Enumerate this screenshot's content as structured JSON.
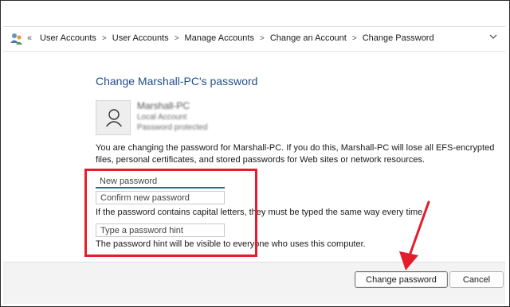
{
  "breadcrumb": {
    "items": [
      "User Accounts",
      "User Accounts",
      "Manage Accounts",
      "Change an Account",
      "Change Password"
    ],
    "back_glyph": "«"
  },
  "page": {
    "title": "Change Marshall-PC's password"
  },
  "account": {
    "name": "Marshall-PC",
    "type": "Local Account",
    "status": "Password protected"
  },
  "description": "You are changing the password for Marshall-PC.  If you do this, Marshall-PC will lose all EFS-encrypted files, personal certificates, and stored passwords for Web sites or network resources.",
  "form": {
    "new_password_placeholder": "New password",
    "confirm_password_placeholder": "Confirm new password",
    "capital_letters_note": "If the password contains capital letters, they must be typed the same way every time.",
    "hint_placeholder": "Type a password hint",
    "hint_visibility_note": "The password hint will be visible to everyone who uses this computer."
  },
  "buttons": {
    "change_password": "Change password",
    "cancel": "Cancel"
  },
  "colors": {
    "title": "#1f4e8c",
    "annotation_red": "#e31d2a",
    "focus_underline": "#2f63a8"
  },
  "icons": [
    "user-accounts-icon",
    "user-avatar-icon",
    "chevron-down-icon",
    "annotation-arrow"
  ]
}
